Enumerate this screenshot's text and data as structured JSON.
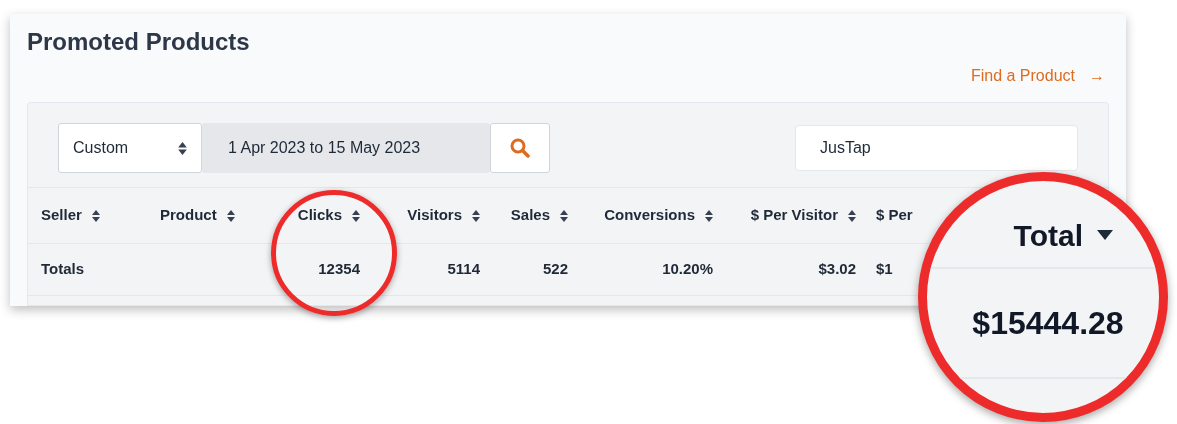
{
  "title": "Promoted Products",
  "find_link": {
    "label": "Find a Product",
    "arrow": "→"
  },
  "filters": {
    "period": "Custom",
    "date_range": "1 Apr 2023 to 15 May 2023",
    "search_value": "JusTap"
  },
  "table": {
    "columns": [
      {
        "label": "Seller",
        "sortable": true,
        "numeric": false
      },
      {
        "label": "Product",
        "sortable": true,
        "numeric": false
      },
      {
        "label": "Clicks",
        "sortable": true,
        "numeric": true
      },
      {
        "label": "Visitors",
        "sortable": true,
        "numeric": true
      },
      {
        "label": "Sales",
        "sortable": true,
        "numeric": true
      },
      {
        "label": "Conversions",
        "sortable": true,
        "numeric": true
      },
      {
        "label": "$ Per Visitor",
        "sortable": true,
        "numeric": true
      },
      {
        "label": "$ Per",
        "sortable": false,
        "numeric": false
      }
    ],
    "totals_row": {
      "label": "Totals",
      "values_from_clicks": [
        "12354",
        "5114",
        "522",
        "10.20%",
        "$3.02",
        "$1"
      ]
    }
  },
  "magnifier": {
    "column": {
      "label": "Total",
      "sorted_descending": true
    },
    "value": "$15444.28"
  },
  "highlight_circles": [
    {
      "kind": "ring"
    }
  ]
}
